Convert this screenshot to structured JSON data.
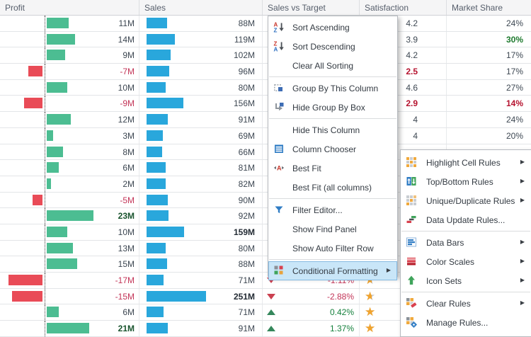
{
  "grid": {
    "columns": [
      "Profit",
      "Sales",
      "Sales vs Target",
      "Satisfaction",
      "Market Share"
    ],
    "rows": [
      {
        "profit_m": 11,
        "profit": "11M",
        "sales_m": 88,
        "sales": "88M",
        "satisfaction": "4.2",
        "market_share": "24%"
      },
      {
        "profit_m": 14,
        "profit": "14M",
        "sales_m": 119,
        "sales": "119M",
        "satisfaction": "3.9",
        "market_share": "30%",
        "market_share_style": "good"
      },
      {
        "profit_m": 9,
        "profit": "9M",
        "sales_m": 102,
        "sales": "102M",
        "satisfaction": "4.2",
        "market_share": "17%"
      },
      {
        "profit_m": -7,
        "profit": "-7M",
        "sales_m": 96,
        "sales": "96M",
        "satisfaction": "2.5",
        "satisfaction_style": "bad",
        "market_share": "17%"
      },
      {
        "profit_m": 10,
        "profit": "10M",
        "sales_m": 80,
        "sales": "80M",
        "satisfaction": "4.6",
        "market_share": "27%"
      },
      {
        "profit_m": -9,
        "profit": "-9M",
        "sales_m": 156,
        "sales": "156M",
        "satisfaction": "2.9",
        "satisfaction_style": "bad",
        "market_share": "14%",
        "market_share_style": "bad"
      },
      {
        "profit_m": 12,
        "profit": "12M",
        "sales_m": 91,
        "sales": "91M",
        "satisfaction": "4",
        "market_share": "24%"
      },
      {
        "profit_m": 3,
        "profit": "3M",
        "sales_m": 69,
        "sales": "69M",
        "satisfaction": "4",
        "market_share": "20%"
      },
      {
        "profit_m": 8,
        "profit": "8M",
        "sales_m": 66,
        "sales": "66M"
      },
      {
        "profit_m": 6,
        "profit": "6M",
        "sales_m": 81,
        "sales": "81M"
      },
      {
        "profit_m": 2,
        "profit": "2M",
        "sales_m": 82,
        "sales": "82M"
      },
      {
        "profit_m": -5,
        "profit": "-5M",
        "sales_m": 90,
        "sales": "90M"
      },
      {
        "profit_m": 23,
        "profit": "23M",
        "profit_bold": true,
        "sales_m": 92,
        "sales": "92M"
      },
      {
        "profit_m": 10,
        "profit": "10M",
        "sales_m": 159,
        "sales": "159M",
        "sales_bold": true
      },
      {
        "profit_m": 13,
        "profit": "13M",
        "sales_m": 80,
        "sales": "80M"
      },
      {
        "profit_m": 15,
        "profit": "15M",
        "sales_m": 88,
        "sales": "88M"
      },
      {
        "profit_m": -17,
        "profit": "-17M",
        "sales_m": 71,
        "sales": "71M",
        "svt": "-1.11%",
        "svt_dir": "down",
        "star": "half"
      },
      {
        "profit_m": -15,
        "profit": "-15M",
        "sales_m": 251,
        "sales": "251M",
        "sales_bold": true,
        "svt": "-2.88%",
        "svt_dir": "down",
        "star": "half"
      },
      {
        "profit_m": 6,
        "profit": "6M",
        "sales_m": 71,
        "sales": "71M",
        "svt": "0.42%",
        "svt_dir": "up",
        "star": "full"
      },
      {
        "profit_m": 21,
        "profit": "21M",
        "profit_bold": true,
        "sales_m": 91,
        "sales": "91M",
        "svt": "1.37%",
        "svt_dir": "up",
        "star": "full"
      }
    ]
  },
  "context_menu": {
    "items": [
      {
        "label": "Sort Ascending",
        "icon": "sort-ascending-icon"
      },
      {
        "label": "Sort Descending",
        "icon": "sort-descending-icon"
      },
      {
        "label": "Clear All Sorting"
      },
      {
        "separator": true
      },
      {
        "label": "Group By This Column",
        "icon": "group-by-column-icon"
      },
      {
        "label": "Hide Group By Box",
        "icon": "hide-group-box-icon"
      },
      {
        "separator": true
      },
      {
        "label": "Hide This Column"
      },
      {
        "label": "Column Chooser",
        "icon": "column-chooser-icon"
      },
      {
        "label": "Best Fit",
        "icon": "best-fit-icon"
      },
      {
        "label": "Best Fit (all columns)"
      },
      {
        "separator": true
      },
      {
        "label": "Filter Editor...",
        "icon": "filter-icon"
      },
      {
        "label": "Show Find Panel"
      },
      {
        "label": "Show Auto Filter Row"
      },
      {
        "separator": true
      },
      {
        "label": "Conditional Formatting",
        "icon": "conditional-formatting-icon",
        "highlighted": true,
        "arrow": true
      }
    ]
  },
  "submenu": {
    "items": [
      {
        "label": "Highlight Cell Rules",
        "icon": "highlight-cell-rules-icon",
        "arrow": true
      },
      {
        "label": "Top/Bottom Rules",
        "icon": "top-bottom-rules-icon",
        "arrow": true
      },
      {
        "label": "Unique/Duplicate Rules",
        "icon": "unique-duplicate-rules-icon",
        "arrow": true
      },
      {
        "label": "Data Update Rules...",
        "icon": "data-update-rules-icon"
      },
      {
        "separator": true
      },
      {
        "label": "Data Bars",
        "icon": "data-bars-icon",
        "arrow": true
      },
      {
        "label": "Color Scales",
        "icon": "color-scales-icon",
        "arrow": true
      },
      {
        "label": "Icon Sets",
        "icon": "icon-sets-icon",
        "arrow": true
      },
      {
        "separator": true
      },
      {
        "label": "Clear Rules",
        "icon": "clear-rules-icon",
        "arrow": true
      },
      {
        "label": "Manage Rules...",
        "icon": "manage-rules-icon"
      }
    ]
  },
  "colors": {
    "positive_bar": "#4cbd92",
    "negative_bar": "#e94b57",
    "sales_bar": "#29a7dc",
    "negative_text": "#c33558",
    "good_text": "#1e7a2e",
    "good_dark": "#19542e",
    "bad_text": "#b5122e",
    "menu_highlight": "#c9e6f8",
    "star_on": "#f0a32e",
    "star_off": "#c6c8ca"
  }
}
